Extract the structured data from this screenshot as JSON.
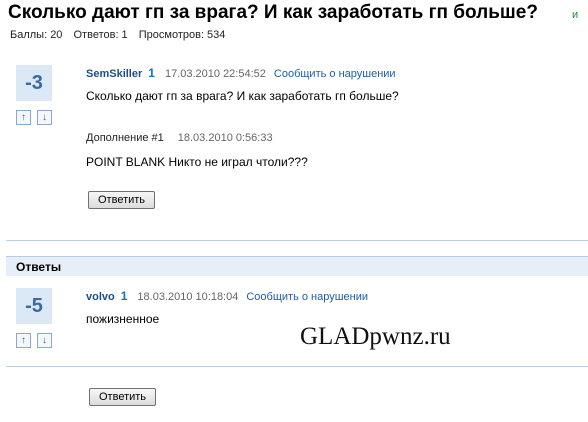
{
  "question": {
    "title": "Сколько дают гп за врага? И как заработать гп больше?",
    "title_tag": "и",
    "stats": {
      "score": "Баллы: 20",
      "answers": "Ответов: 1",
      "views": "Просмотров: 534"
    },
    "votes": "-3",
    "author": "SemSkiller",
    "badge": "1",
    "date": "17.03.2010 22:54:52",
    "report": "Сообщить о нарушении",
    "text": "Сколько дают гп за врага? И как заработать гп больше?",
    "addition_label": "Дополнение #1",
    "addition_date": "18.03.2010 0:56:33",
    "addition_text": "POINT BLANK Никто не играл чтоли???",
    "reply_button": "Ответить"
  },
  "answers_header": "Ответы",
  "answer": {
    "votes": "-5",
    "author": "volvo",
    "badge": "1",
    "date": "18.03.2010 10:18:04",
    "report": "Сообщить о нарушении",
    "text": "пожизненное"
  },
  "bottom_reply_button": "Ответить",
  "watermark": "GLADpwnz.ru",
  "icons": {
    "vote_up": "arrow-up-icon",
    "vote_down": "arrow-down-icon"
  },
  "colors": {
    "vote_box_bg": "#dbe8f5",
    "vote_text": "#3c6aa0",
    "link": "#1c5fa8",
    "answers_header_bg": "#e6eef7"
  }
}
